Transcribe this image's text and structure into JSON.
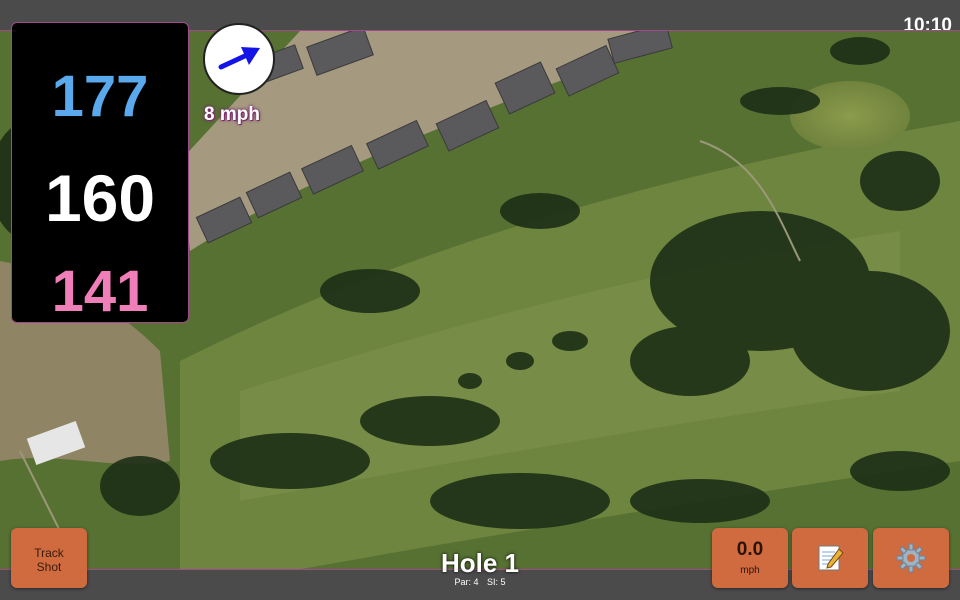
{
  "status_bar": {
    "time": "10:10"
  },
  "yardage": {
    "back": "177",
    "middle": "160",
    "front": "141"
  },
  "wind": {
    "speed": "8 mph",
    "direction_icon": "arrow-icon",
    "arrow_color": "#1414e6"
  },
  "hole": {
    "title": "Hole 1",
    "par": "Par: 4",
    "si": "SI: 5"
  },
  "buttons": {
    "track_line1": "Track",
    "track_line2": "Shot",
    "speed_value": "0.0",
    "speed_unit": "mph",
    "notes_icon": "notepad-icon",
    "settings_icon": "gear-icon"
  },
  "colors": {
    "button": "#d06b40",
    "back_yardage": "#5aa9ec",
    "middle_yardage": "#ffffff",
    "front_yardage": "#f07fb9",
    "border_accent": "#a24a8f"
  }
}
